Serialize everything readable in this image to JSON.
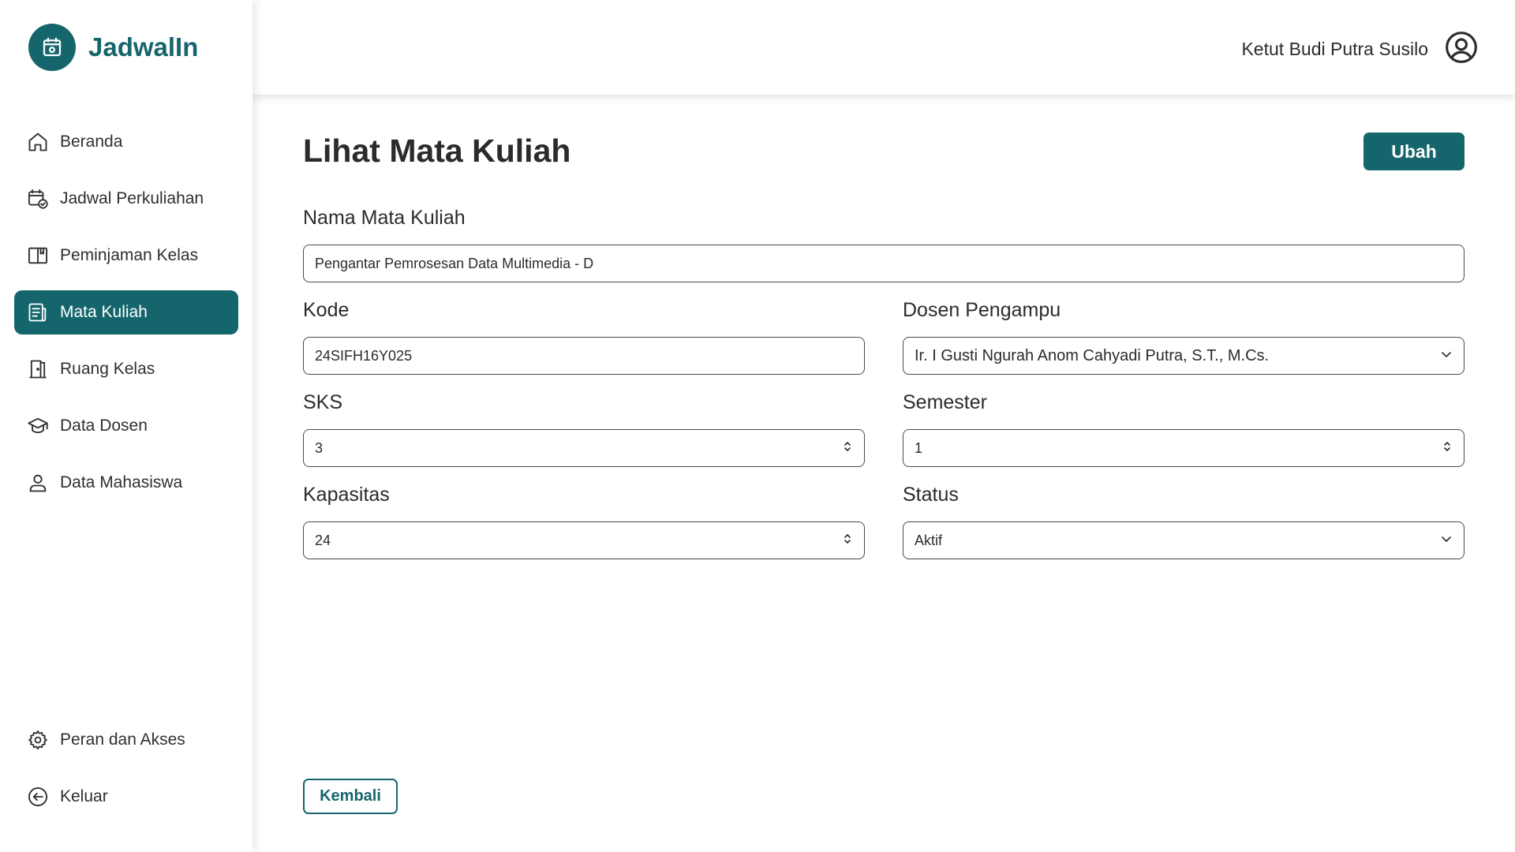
{
  "app": {
    "name": "JadwalIn",
    "accent_color": "#15666c"
  },
  "sidebar": {
    "items": [
      {
        "label": "Beranda",
        "icon": "home-icon",
        "active": false
      },
      {
        "label": "Jadwal Perkuliahan",
        "icon": "calendar-check-icon",
        "active": false
      },
      {
        "label": "Peminjaman Kelas",
        "icon": "book-open-icon",
        "active": false
      },
      {
        "label": "Mata Kuliah",
        "icon": "document-list-icon",
        "active": true
      },
      {
        "label": "Ruang Kelas",
        "icon": "door-icon",
        "active": false
      },
      {
        "label": "Data Dosen",
        "icon": "graduation-cap-icon",
        "active": false
      },
      {
        "label": "Data Mahasiswa",
        "icon": "user-icon",
        "active": false
      }
    ],
    "bottom_items": [
      {
        "label": "Peran dan Akses",
        "icon": "gear-icon"
      },
      {
        "label": "Keluar",
        "icon": "arrow-left-circle-icon"
      }
    ]
  },
  "header": {
    "user_name": "Ketut Budi Putra Susilo",
    "avatar_icon": "user-circle-icon"
  },
  "page": {
    "title": "Lihat Mata Kuliah",
    "edit_button": "Ubah",
    "back_button": "Kembali",
    "fields": {
      "nama": {
        "label": "Nama Mata Kuliah",
        "value": "Pengantar Pemrosesan Data Multimedia - D"
      },
      "kode": {
        "label": "Kode",
        "value": "24SIFH16Y025"
      },
      "dosen": {
        "label": "Dosen Pengampu",
        "value": "Ir. I Gusti Ngurah Anom Cahyadi Putra, S.T., M.Cs."
      },
      "sks": {
        "label": "SKS",
        "value": "3"
      },
      "semester": {
        "label": "Semester",
        "value": "1"
      },
      "kapasitas": {
        "label": "Kapasitas",
        "value": "24"
      },
      "status": {
        "label": "Status",
        "value": "Aktif"
      }
    }
  }
}
